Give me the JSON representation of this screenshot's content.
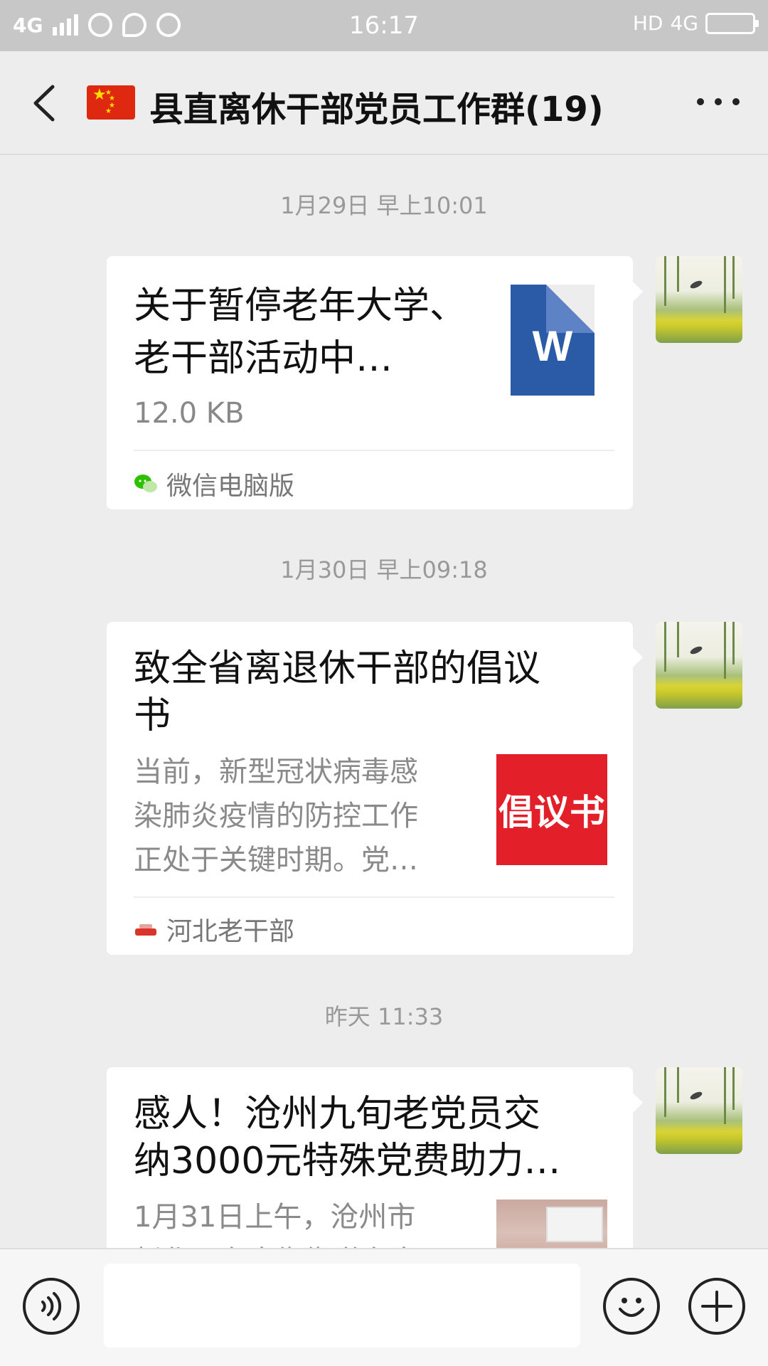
{
  "status_bar": {
    "network": "4G",
    "time": "16:17",
    "hd": "HD",
    "network_right": "4G"
  },
  "header": {
    "title": "县直离休干部党员工作群(19)",
    "flag_icon": "china-flag-icon",
    "back_icon": "chevron-left-icon",
    "more_icon": "more-dots-icon"
  },
  "messages": [
    {
      "timestamp": "1月29日 早上10:01",
      "type": "file",
      "title_line1": "关于暂停老年大学、",
      "title_line2": "老干部活动中…",
      "size": "12.0 KB",
      "file_icon_letter": "W",
      "source": "微信电脑版"
    },
    {
      "timestamp": "1月30日 早上09:18",
      "type": "article",
      "title_line1": "致全省离退休干部的倡议",
      "title_line2": "书",
      "desc_line1": "当前，新型冠状病毒感",
      "desc_line2": "染肺炎疫情的防控工作",
      "desc_line3": "正处于关键时期。党…",
      "thumb_text": "倡议书",
      "source": "河北老干部"
    },
    {
      "timestamp": "昨天 11:33",
      "type": "article",
      "title_line1": "感人！沧州九旬老党员交",
      "title_line2": "纳3000元特殊党费助力…",
      "desc_line1": "1月31日上午，沧州市",
      "desc_line2": "新华区东大街街道东南"
    }
  ],
  "colors": {
    "chat_background": "#ededed",
    "bubble": "#ffffff",
    "word_blue": "#2b5aa6",
    "thumb_red": "#e3202a",
    "wechat_green": "#2dc100"
  },
  "input_bar": {
    "placeholder": "",
    "voice_icon": "voice-icon",
    "emoji_icon": "emoji-icon",
    "plus_icon": "plus-icon"
  }
}
